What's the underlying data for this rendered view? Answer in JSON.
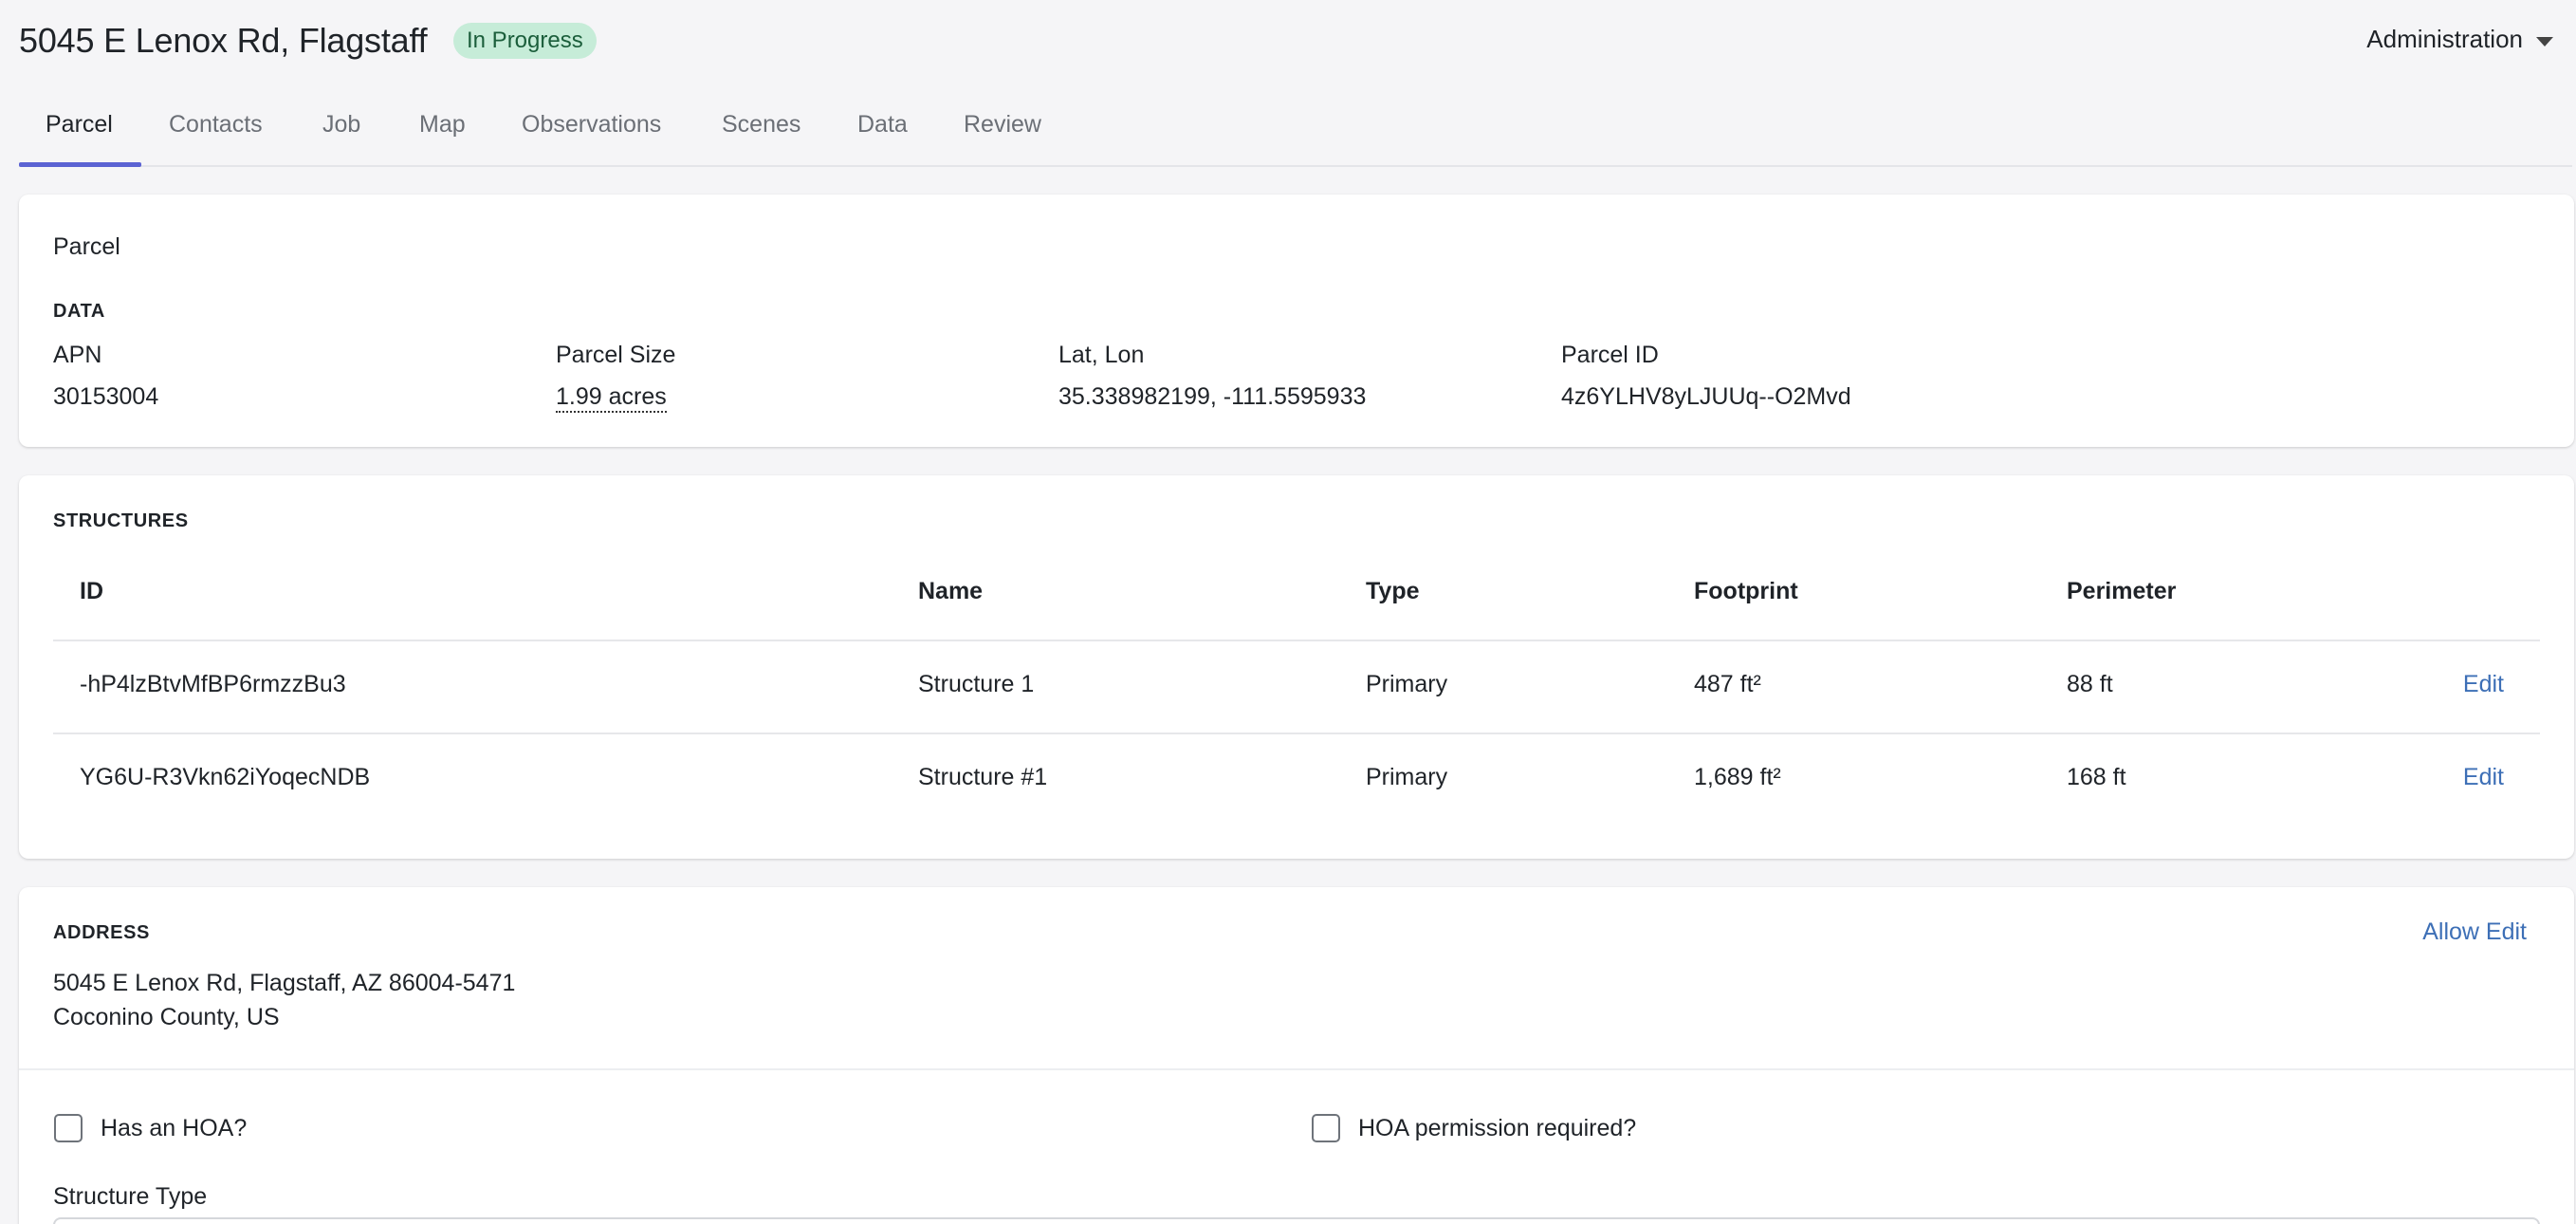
{
  "header": {
    "title": "5045 E Lenox Rd, Flagstaff",
    "status_badge": "In Progress",
    "admin_menu": "Administration"
  },
  "tabs": [
    {
      "label": "Parcel",
      "active": true
    },
    {
      "label": "Contacts"
    },
    {
      "label": "Job"
    },
    {
      "label": "Map"
    },
    {
      "label": "Observations"
    },
    {
      "label": "Scenes"
    },
    {
      "label": "Data"
    },
    {
      "label": "Review"
    }
  ],
  "parcel_card": {
    "heading": "Parcel",
    "section": "DATA",
    "fields": [
      {
        "label": "APN",
        "value": "30153004"
      },
      {
        "label": "Parcel Size",
        "value": "1.99 acres"
      },
      {
        "label": "Lat, Lon",
        "value": "35.338982199, -111.5595933"
      },
      {
        "label": "Parcel ID",
        "value": "4z6YLHV8yLJUUq--O2Mvd"
      }
    ]
  },
  "structures_card": {
    "section": "STRUCTURES",
    "columns": [
      "ID",
      "Name",
      "Type",
      "Footprint",
      "Perimeter"
    ],
    "rows": [
      {
        "id": "-hP4lzBtvMfBP6rmzzBu3",
        "name": "Structure 1",
        "type": "Primary",
        "footprint": "487 ft²",
        "perimeter": "88 ft",
        "action": "Edit"
      },
      {
        "id": "YG6U-R3Vkn62iYoqecNDB",
        "name": "Structure #1",
        "type": "Primary",
        "footprint": "1,689 ft²",
        "perimeter": "168 ft",
        "action": "Edit"
      }
    ]
  },
  "address_card": {
    "section": "ADDRESS",
    "allow_edit": "Allow Edit",
    "line1": "5045 E Lenox Rd, Flagstaff, AZ 86004-5471",
    "line2": "Coconino County, US",
    "checkboxes": [
      {
        "label": "Has an HOA?",
        "checked": false
      },
      {
        "label": "HOA permission required?",
        "checked": false
      }
    ],
    "structure_type_label": "Structure Type"
  },
  "colors": {
    "accent": "#5b63d3",
    "link": "#3d6fb6",
    "badge_bg": "#c6ecd8",
    "badge_text": "#1b5e3b"
  },
  "icons": {
    "admin_menu": "chevron-down-icon"
  }
}
